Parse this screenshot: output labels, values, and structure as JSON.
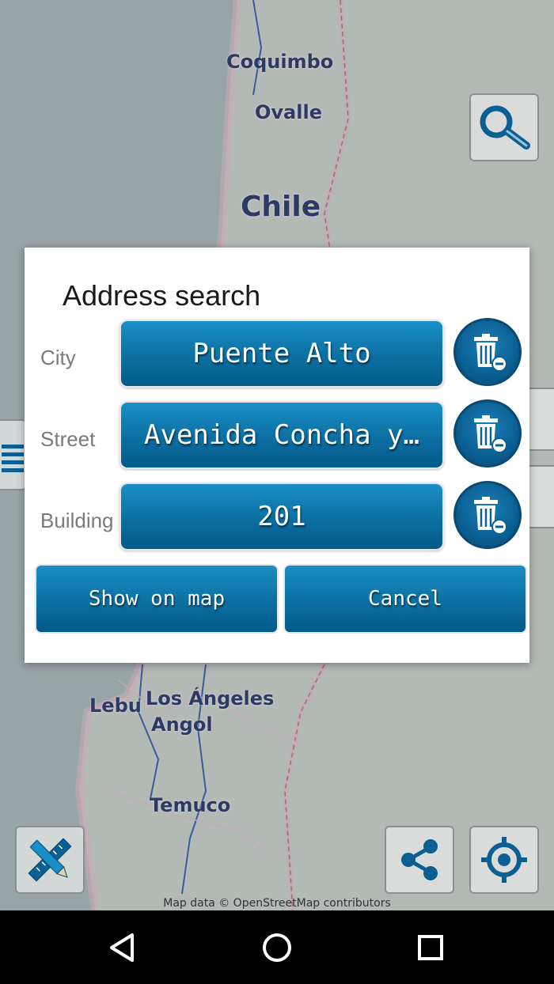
{
  "map": {
    "labels": [
      "Coquimbo",
      "Ovalle",
      "Chile",
      "Lebu",
      "Los Ángeles",
      "Angol",
      "Temuco"
    ],
    "attribution": "Map data © OpenStreetMap contributors"
  },
  "map_buttons": {
    "search_icon": "magnifier-icon",
    "tools_icon": "ruler-pencil-icon",
    "share_icon": "share-icon",
    "locate_icon": "crosshair-icon",
    "list_icon": "list-icon"
  },
  "dialog": {
    "title": "Address search",
    "rows": [
      {
        "label": "City",
        "value": "Puente Alto"
      },
      {
        "label": "Street",
        "value": "Avenida Concha y…"
      },
      {
        "label": "Building",
        "value": "201"
      }
    ],
    "show_on_map": "Show on map",
    "cancel": "Cancel"
  },
  "nav": {
    "back_icon": "back-triangle-icon",
    "home_icon": "home-circle-icon",
    "recents_icon": "recents-square-icon"
  },
  "colors": {
    "button_blue": "#0c6fa2",
    "map_bg": "#a5b0b0",
    "label_color": "#2e3a66"
  }
}
